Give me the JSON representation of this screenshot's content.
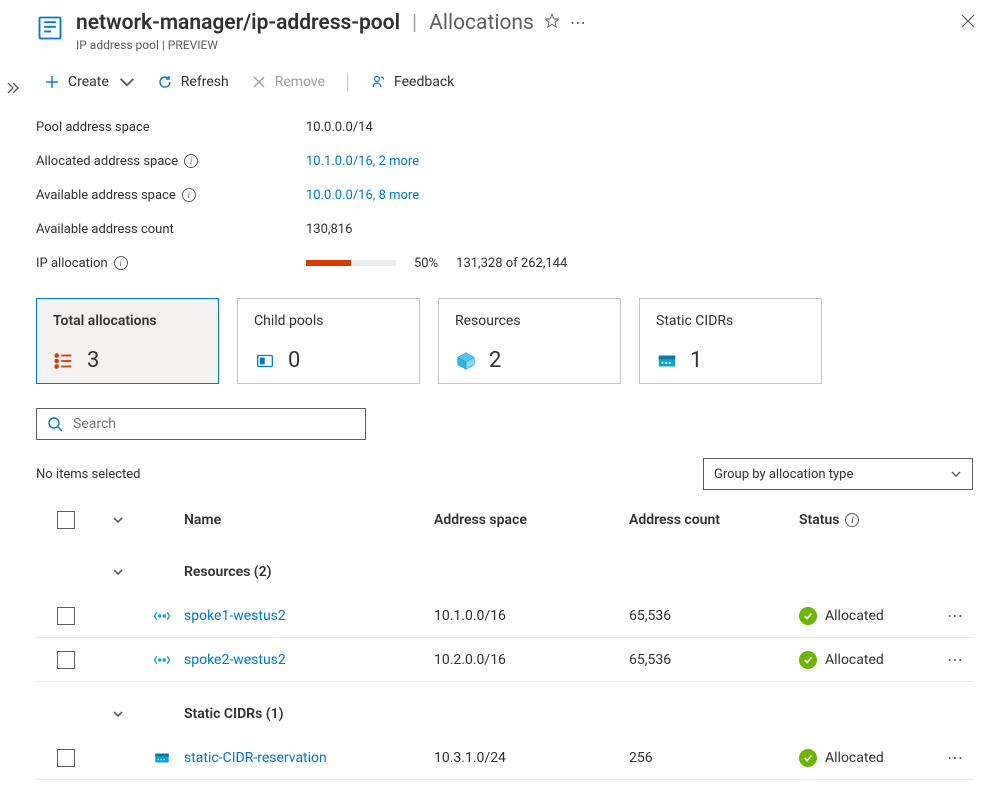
{
  "header": {
    "breadcrumb_title": "network-manager/ip-address-pool",
    "breadcrumb_page": "Allocations",
    "subtitle": "IP address pool | PREVIEW"
  },
  "toolbar": {
    "create": "Create",
    "refresh": "Refresh",
    "remove": "Remove",
    "feedback": "Feedback"
  },
  "info": {
    "pool_label": "Pool address space",
    "pool_value": "10.0.0.0/14",
    "allocated_label": "Allocated address space",
    "allocated_value": "10.1.0.0/16, 2 more",
    "available_label": "Available address space",
    "available_value": "10.0.0.0/16, 8 more",
    "count_label": "Available address count",
    "count_value": "130,816",
    "alloc_label": "IP allocation",
    "alloc_pct": "50%",
    "alloc_of": "131,328 of 262,144",
    "alloc_fill_pct": 50
  },
  "cards": [
    {
      "title": "Total allocations",
      "count": "3"
    },
    {
      "title": "Child pools",
      "count": "0"
    },
    {
      "title": "Resources",
      "count": "2"
    },
    {
      "title": "Static CIDRs",
      "count": "1"
    }
  ],
  "search": {
    "placeholder": "Search"
  },
  "selection": {
    "no_items": "No items selected",
    "group_by": "Group by allocation type"
  },
  "table": {
    "headers": {
      "name": "Name",
      "space": "Address space",
      "count": "Address count",
      "status": "Status"
    },
    "groups": [
      {
        "label": "Resources (2)",
        "icon": "vnet",
        "rows": [
          {
            "name": "spoke1-westus2",
            "space": "10.1.0.0/16",
            "count": "65,536",
            "status": "Allocated"
          },
          {
            "name": "spoke2-westus2",
            "space": "10.2.0.0/16",
            "count": "65,536",
            "status": "Allocated"
          }
        ]
      },
      {
        "label": "Static CIDRs (1)",
        "icon": "cidr",
        "rows": [
          {
            "name": "static-CIDR-reservation",
            "space": "10.3.1.0/24",
            "count": "256",
            "status": "Allocated"
          }
        ]
      }
    ]
  }
}
